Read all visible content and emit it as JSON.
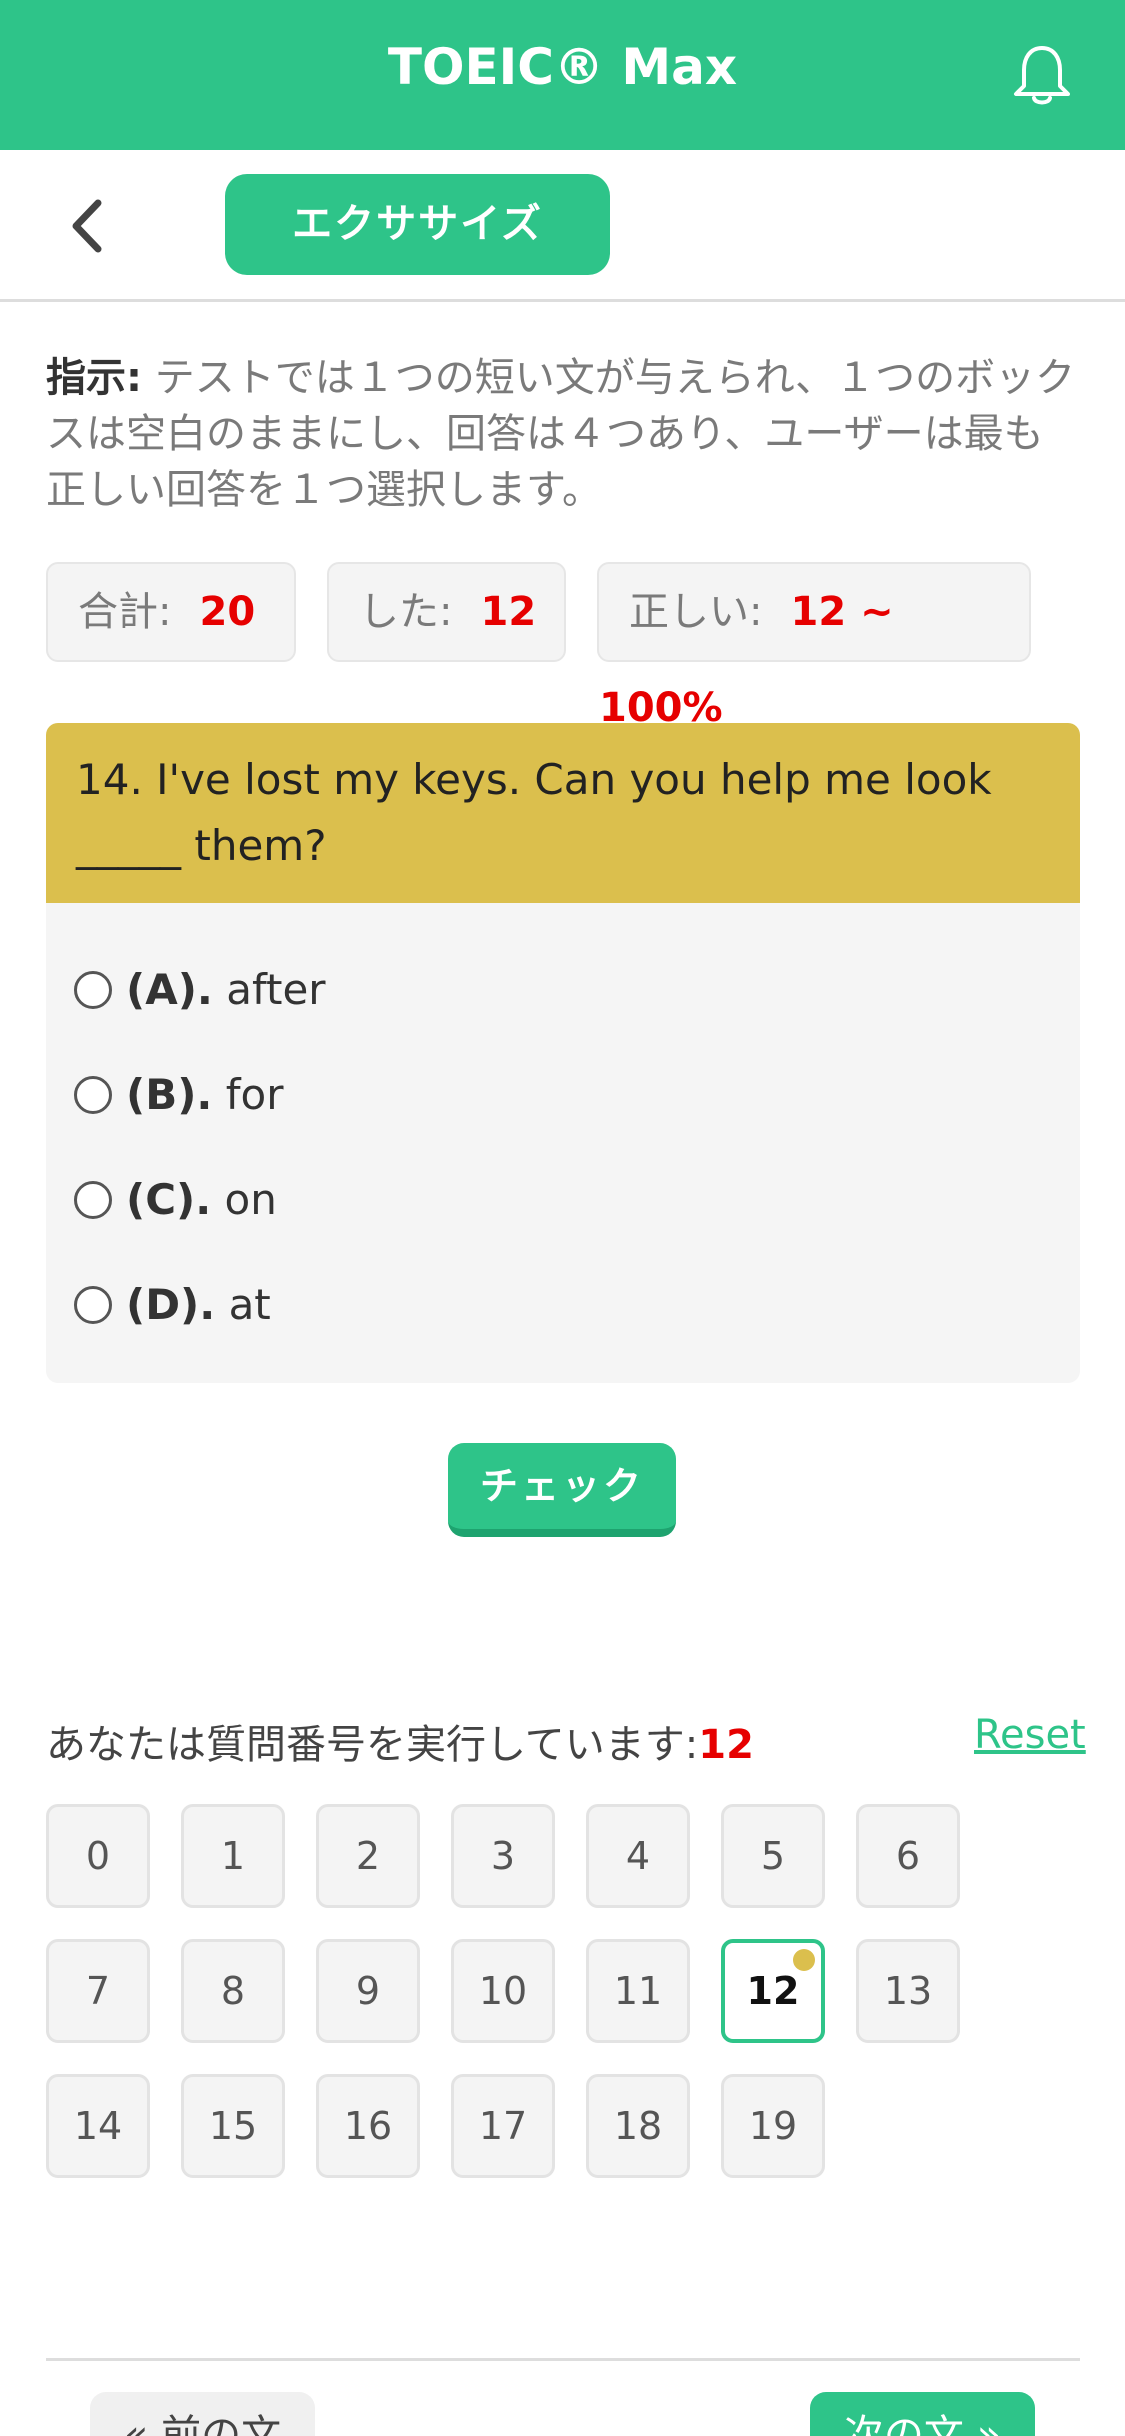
{
  "header": {
    "title": "TOEIC® Max",
    "bell_icon": "bell-icon"
  },
  "subbar": {
    "back_icon": "chevron-left-icon",
    "tab_label": "エクササイズ"
  },
  "instruction": {
    "label": "指示:",
    "text": " テストでは１つの短い文が与えられ、１つのボックスは空白のままにし、回答は４つあり、ユーザーは最も正しい回答を１つ選択します。"
  },
  "stats": {
    "total_label": "合計:",
    "total_value": "20",
    "done_label": "した:",
    "done_value": "12",
    "correct_label": "正しい:",
    "correct_value": "12 ~ 100%"
  },
  "question": {
    "text": "14. I've lost my keys. Can you help me look _____ them?",
    "options": [
      {
        "key": "(A).",
        "text": " after"
      },
      {
        "key": "(B).",
        "text": " for"
      },
      {
        "key": "(C).",
        "text": " on"
      },
      {
        "key": "(D).",
        "text": " at"
      }
    ]
  },
  "check_label": "チェック",
  "progress": {
    "label": "あなたは質問番号を実行しています:",
    "current": "12",
    "reset_label": "Reset"
  },
  "grid": [
    "0",
    "1",
    "2",
    "3",
    "4",
    "5",
    "6",
    "7",
    "8",
    "9",
    "10",
    "11",
    "12",
    "13",
    "14",
    "15",
    "16",
    "17",
    "18",
    "19"
  ],
  "grid_active_index": 12,
  "nav": {
    "prev_label": "« 前の文",
    "next_label": "次の文 »"
  },
  "colors": {
    "accent": "#2ec489",
    "question_header": "#dbbf4d",
    "highlight": "#e60000"
  }
}
